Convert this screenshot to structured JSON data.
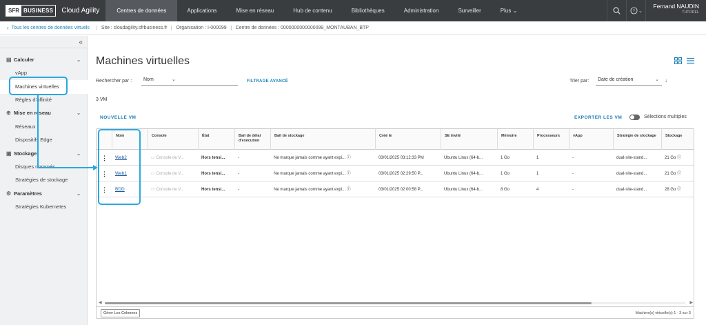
{
  "topbar": {
    "logo_left": "SFR",
    "logo_right": "BUSINESS",
    "app_name": "Cloud Agility",
    "nav": [
      "Centres de données",
      "Applications",
      "Mise en réseau",
      "Hub de contenu",
      "Bibliothèques",
      "Administration",
      "Surveiller",
      "Plus"
    ],
    "active_nav": "Centres de données",
    "search_icon": "search-icon",
    "help_icon": "help-icon",
    "user_name": "Fernand NAUDIN",
    "user_role": "TUTOREL"
  },
  "breadcrumb": {
    "back": "Tous les centres de données virtuels",
    "site": "Site : cloudagility.sfrbusiness.fr",
    "org": "Organisation : I-000099",
    "datacenter": "Centre de données : 0000000000000099_MONTAUBAN_BTP"
  },
  "sidebar": {
    "groups": [
      {
        "label": "Calculer",
        "icon": "compute-icon",
        "items": [
          "vApp",
          "Machines virtuelles",
          "Règles d'affinité"
        ]
      },
      {
        "label": "Mise en réseau",
        "icon": "network-icon",
        "items": [
          "Réseaux",
          "Dispositifs Edge"
        ]
      },
      {
        "label": "Stockage",
        "icon": "storage-icon",
        "items": [
          "Disques nommés",
          "Stratégies de stockage"
        ]
      },
      {
        "label": "Paramètres",
        "icon": "gear-icon",
        "items": [
          "Stratégies Kubernetes"
        ]
      }
    ],
    "active_item": "Machines virtuelles"
  },
  "main": {
    "title": "Machines virtuelles",
    "search_label": "Rechercher par :",
    "search_value": "Nom",
    "advanced_filter": "FILTRAGE AVANCÉ",
    "sort_label": "Trier par:",
    "sort_value": "Date de création",
    "count": "3 VM",
    "new_vm": "NOUVELLE VM",
    "export": "EXPORTER LES VM",
    "multi_select": "Sélections multiples",
    "manage_columns": "Gérer Les Colonnes",
    "pager": "Machine(s) virtuelle(s) 1 - 3 sur 3"
  },
  "table": {
    "headers": [
      "Nom",
      "Console",
      "État",
      "Bail de délai d'exécution",
      "Bail de stockage",
      "Créé le",
      "SE invité",
      "Mémoire",
      "Processeurs",
      "vApp",
      "Stratégie de stockage",
      "Stockage"
    ],
    "rows": [
      [
        "Web2",
        "Console de V...",
        "Hors tensi...",
        "-",
        "Ne marque jamais comme ayant expi...",
        "03/01/2025 03:12:33 PM",
        "Ubuntu Linux (64-b...",
        "1 Go",
        "1",
        "-",
        "dual-site-stand...",
        "21 Go"
      ],
      [
        "Web1",
        "Console de V...",
        "Hors tensi...",
        "-",
        "Ne marque jamais comme ayant expi...",
        "03/01/2025 02:29:50 P...",
        "Ubuntu Linux (64-b...",
        "1 Go",
        "1",
        "-",
        "dual-site-stand...",
        "21 Go"
      ],
      [
        "BDD",
        "Console de V...",
        "Hors tensi...",
        "-",
        "Ne marque jamais comme ayant expi...",
        "03/01/2025 02:00:58 P...",
        "Ubuntu Linux (64-b...",
        "8 Go",
        "4",
        "-",
        "dual-site-stand...",
        "28 Go"
      ]
    ]
  },
  "annotation_color": "#29a8e0"
}
